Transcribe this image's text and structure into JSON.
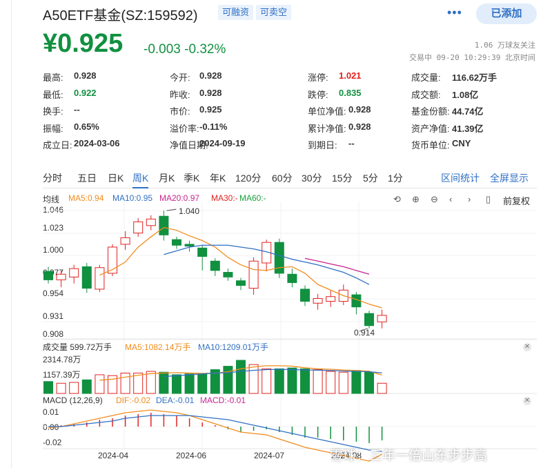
{
  "header": {
    "title": "A50ETF基金(SZ:159592)",
    "tags": [
      "可融资",
      "可卖空"
    ],
    "more_icon": "more-dots-icon",
    "add_label": "已添加"
  },
  "quote": {
    "price": "¥0.925",
    "change": "-0.003",
    "change_pct": "-0.32%",
    "followers": "1.06 万球友关注",
    "trade_time": "交易中 09-20 10:29:39 北京时间"
  },
  "stats": {
    "rows": [
      [
        {
          "k": "最高:",
          "v": "0.928"
        },
        {
          "k": "今开:",
          "v": "0.928"
        },
        {
          "k": "涨停:",
          "v": "1.021",
          "color": "red"
        },
        {
          "k": "成交量:",
          "v": "116.62万手"
        }
      ],
      [
        {
          "k": "最低:",
          "v": "0.922",
          "color": "green"
        },
        {
          "k": "昨收:",
          "v": "0.928"
        },
        {
          "k": "跌停:",
          "v": "0.835",
          "color": "green"
        },
        {
          "k": "成交额:",
          "v": "1.08亿"
        }
      ],
      [
        {
          "k": "换手:",
          "v": "--"
        },
        {
          "k": "市价:",
          "v": "0.925"
        },
        {
          "k": "单位净值:",
          "v": "0.928"
        },
        {
          "k": "基金份额:",
          "v": "44.74亿"
        }
      ],
      [
        {
          "k": "振幅:",
          "v": "0.65%"
        },
        {
          "k": "溢价率:",
          "v": "-0.11%"
        },
        {
          "k": "累计净值:",
          "v": "0.928"
        },
        {
          "k": "资产净值:",
          "v": "41.39亿"
        }
      ],
      [
        {
          "k": "成立日:",
          "v": "2024-03-06"
        },
        {
          "k": "净值日期:",
          "v": "2024-09-19"
        },
        {
          "k": "到期日:",
          "v": "--"
        },
        {
          "k": "货币单位:",
          "v": "CNY"
        }
      ]
    ]
  },
  "tabs": {
    "items": [
      "分时",
      "五日",
      "日K",
      "周K",
      "月K",
      "季K",
      "年K",
      "120分",
      "60分",
      "30分",
      "15分",
      "5分",
      "1分"
    ],
    "active": "周K",
    "range_stats": "区间统计",
    "fullscreen": "全屏显示"
  },
  "legend": {
    "ma_title": "均线",
    "ma": [
      {
        "label": "MA5:0.94",
        "color": "#f28c1c"
      },
      {
        "label": "MA10:0.95",
        "color": "#2f6fc4"
      },
      {
        "label": "MA20:0.97",
        "color": "#c8238c"
      },
      {
        "label": "MA30:-",
        "color": "#e0221f"
      },
      {
        "label": "MA60:-",
        "color": "#1a9e3a"
      }
    ],
    "toolbar_icons": [
      "back-icon",
      "zoom-in-icon",
      "zoom-out-icon",
      "scroll-left-icon",
      "scroll-right-icon",
      "phone-icon"
    ],
    "adjust": "前复权",
    "vol_title": "成交量 599.72万手",
    "vol_ma5": "MA5:1082.14万手",
    "vol_ma10": "MA10:1209.01万手",
    "macd_title": "MACD (12,26,9)",
    "dif": "DIF:-0.02",
    "dea": "DEA:-0.01",
    "macd": "MACD:-0.01"
  },
  "axes": {
    "price_ticks": [
      "1.046",
      "1.023",
      "1.000",
      "0.977",
      "0.954",
      "0.931",
      "0.908"
    ],
    "vol_ticks": [
      "2314.78万",
      "1157.39万"
    ],
    "macd_ticks": [
      "0.01",
      "0.00",
      "-0.02"
    ],
    "dates": [
      "2024-04",
      "2024-06",
      "2024-07",
      "2024-08"
    ],
    "high_label": "1.040",
    "low_label": "0.914"
  },
  "chart_data": {
    "type": "candlestick",
    "ylim": [
      0.905,
      1.046
    ],
    "candles": [
      {
        "o": 0.975,
        "c": 0.966,
        "h": 0.98,
        "l": 0.962
      },
      {
        "o": 0.966,
        "c": 0.972,
        "h": 0.976,
        "l": 0.958
      },
      {
        "o": 0.969,
        "c": 0.978,
        "h": 0.982,
        "l": 0.962
      },
      {
        "o": 0.98,
        "c": 0.957,
        "h": 0.984,
        "l": 0.952
      },
      {
        "o": 0.956,
        "c": 0.979,
        "h": 0.982,
        "l": 0.953
      },
      {
        "o": 0.973,
        "c": 1.001,
        "h": 1.004,
        "l": 0.97
      },
      {
        "o": 1.004,
        "c": 1.011,
        "h": 1.018,
        "l": 0.998
      },
      {
        "o": 1.016,
        "c": 1.028,
        "h": 1.032,
        "l": 1.012
      },
      {
        "o": 1.024,
        "c": 1.031,
        "h": 1.035,
        "l": 1.019
      },
      {
        "o": 1.034,
        "c": 1.014,
        "h": 1.04,
        "l": 1.008
      },
      {
        "o": 1.009,
        "c": 1.003,
        "h": 1.012,
        "l": 0.999
      },
      {
        "o": 1.004,
        "c": 1.002,
        "h": 1.008,
        "l": 0.996
      },
      {
        "o": 1.0,
        "c": 0.991,
        "h": 1.003,
        "l": 0.976
      },
      {
        "o": 0.986,
        "c": 0.976,
        "h": 0.989,
        "l": 0.97
      },
      {
        "o": 0.974,
        "c": 0.969,
        "h": 0.978,
        "l": 0.965
      },
      {
        "o": 0.965,
        "c": 0.96,
        "h": 0.968,
        "l": 0.955
      },
      {
        "o": 0.957,
        "c": 0.986,
        "h": 0.99,
        "l": 0.95
      },
      {
        "o": 0.984,
        "c": 1.006,
        "h": 1.009,
        "l": 0.975
      },
      {
        "o": 1.006,
        "c": 0.973,
        "h": 1.01,
        "l": 0.968
      },
      {
        "o": 0.972,
        "c": 0.963,
        "h": 0.978,
        "l": 0.958
      },
      {
        "o": 0.956,
        "c": 0.943,
        "h": 0.96,
        "l": 0.938
      },
      {
        "o": 0.941,
        "c": 0.946,
        "h": 0.951,
        "l": 0.934
      },
      {
        "o": 0.943,
        "c": 0.948,
        "h": 0.955,
        "l": 0.937
      },
      {
        "o": 0.943,
        "c": 0.955,
        "h": 0.961,
        "l": 0.939
      },
      {
        "o": 0.95,
        "c": 0.937,
        "h": 0.953,
        "l": 0.929
      },
      {
        "o": 0.93,
        "c": 0.917,
        "h": 0.933,
        "l": 0.914
      },
      {
        "o": 0.921,
        "c": 0.928,
        "h": 0.934,
        "l": 0.914
      }
    ],
    "ma5": [
      null,
      null,
      null,
      null,
      0.971,
      0.977,
      0.985,
      1.001,
      1.012,
      1.022,
      1.019,
      1.013,
      1.008,
      1.001,
      0.99,
      0.982,
      0.977,
      0.976,
      0.979,
      0.98,
      0.973,
      0.961,
      0.955,
      0.949,
      0.945,
      0.94,
      0.936
    ],
    "ma10": [
      null,
      null,
      null,
      null,
      null,
      null,
      null,
      null,
      null,
      0.993,
      0.997,
      1.001,
      1.003,
      1.003,
      1.003,
      1.001,
      0.999,
      0.996,
      0.992,
      0.988,
      0.985,
      0.982,
      0.978,
      0.974,
      0.968,
      0.961
    ],
    "ma20": [
      null,
      null,
      null,
      null,
      null,
      null,
      null,
      null,
      null,
      null,
      null,
      null,
      null,
      null,
      null,
      null,
      null,
      null,
      null,
      null,
      0.989,
      0.986,
      0.983,
      0.98,
      0.976,
      0.972
    ],
    "volume": [
      700,
      600,
      650,
      800,
      1100,
      1050,
      1200,
      1200,
      1300,
      1250,
      1100,
      1150,
      1150,
      1400,
      1600,
      1950,
      1700,
      1450,
      1450,
      1500,
      1450,
      1400,
      1300,
      1250,
      1350,
      1250,
      599.72
    ],
    "vol_up": [
      false,
      true,
      true,
      false,
      true,
      true,
      true,
      true,
      true,
      false,
      false,
      false,
      false,
      false,
      false,
      false,
      true,
      true,
      false,
      false,
      false,
      true,
      true,
      true,
      false,
      false,
      true
    ],
    "vol_ma5": [
      null,
      null,
      null,
      null,
      780,
      840,
      960,
      1070,
      1170,
      1200,
      1220,
      1200,
      1180,
      1190,
      1280,
      1450,
      1560,
      1630,
      1630,
      1610,
      1510,
      1450,
      1420,
      1380,
      1350,
      1310,
      1082.14
    ],
    "vol_ma10": [
      null,
      null,
      null,
      null,
      null,
      null,
      null,
      null,
      null,
      1000,
      1040,
      1100,
      1150,
      1200,
      1220,
      1300,
      1360,
      1400,
      1420,
      1400,
      1380,
      1370,
      1350,
      1320,
      1300,
      1280,
      1209.01
    ],
    "macd_hist": [
      0.0,
      0.001,
      0.002,
      0.003,
      0.005,
      0.006,
      0.008,
      0.009,
      0.01,
      0.009,
      0.008,
      0.006,
      0.003,
      0.001,
      -0.002,
      -0.004,
      -0.003,
      -0.002,
      -0.004,
      -0.006,
      -0.008,
      -0.008,
      -0.009,
      -0.01,
      -0.011,
      -0.012,
      -0.01
    ],
    "dif": [
      -0.001,
      0.0,
      0.002,
      0.004,
      0.006,
      0.008,
      0.01,
      0.011,
      0.012,
      0.011,
      0.01,
      0.008,
      0.005,
      0.002,
      -0.001,
      -0.004,
      -0.005,
      -0.006,
      -0.009,
      -0.012,
      -0.015,
      -0.017,
      -0.019,
      -0.021,
      -0.023,
      -0.025,
      -0.02
    ],
    "dea": [
      0.0,
      0.0,
      0.001,
      0.002,
      0.003,
      0.004,
      0.006,
      0.007,
      0.008,
      0.008,
      0.008,
      0.008,
      0.007,
      0.006,
      0.005,
      0.003,
      0.001,
      -0.001,
      -0.003,
      -0.005,
      -0.007,
      -0.009,
      -0.011,
      -0.013,
      -0.015,
      -0.017,
      -0.018
    ]
  },
  "watermark": "雪球：三年一倍山东步步高"
}
